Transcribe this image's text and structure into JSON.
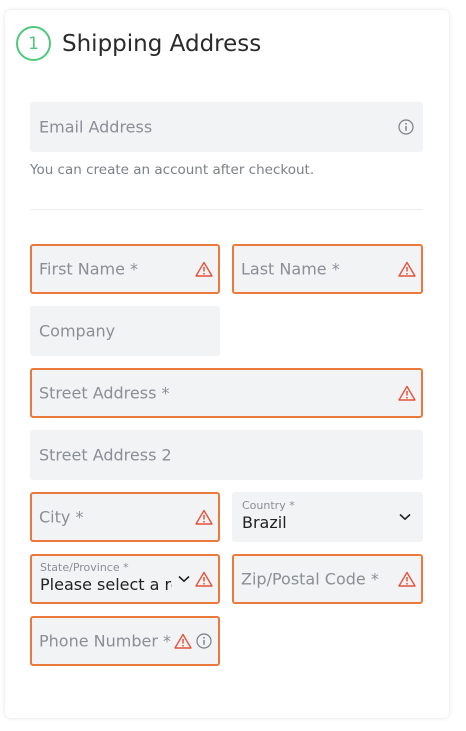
{
  "header": {
    "step": "1",
    "title": "Shipping Address"
  },
  "email": {
    "placeholder": "Email Address",
    "helper": "You can create an account after checkout."
  },
  "first_name": {
    "placeholder": "First Name *"
  },
  "last_name": {
    "placeholder": "Last Name *"
  },
  "company": {
    "placeholder": "Company"
  },
  "street1": {
    "placeholder": "Street Address *"
  },
  "street2": {
    "placeholder": "Street Address 2"
  },
  "city": {
    "placeholder": "City *"
  },
  "country": {
    "label": "Country *",
    "value": "Brazil"
  },
  "state": {
    "label": "State/Province *",
    "value": "Please select a region"
  },
  "zip": {
    "placeholder": "Zip/Postal Code *"
  },
  "phone": {
    "placeholder": "Phone Number *"
  },
  "colors": {
    "error": "#e97a3c",
    "step_green": "#4ec97a",
    "field_bg": "#f1f3f5"
  }
}
